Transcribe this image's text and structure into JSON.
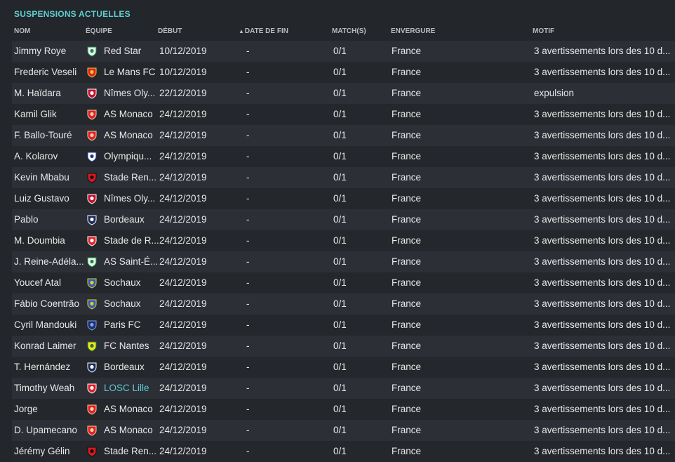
{
  "title": "SUSPENSIONS ACTUELLES",
  "columns": {
    "name": "NOM",
    "team": "ÉQUIPE",
    "start": "DÉBUT",
    "end": "DATE DE FIN",
    "matches": "MATCH(S)",
    "scope": "ENVERGURE",
    "reason": "MOTIF"
  },
  "rows": [
    {
      "name": "Jimmy Roye",
      "team": "Red Star",
      "start": "10/12/2019",
      "end": "-",
      "matches": "0/1",
      "scope": "France",
      "reason": "3 avertissements lors des 10 d...",
      "crest": "red-star",
      "color": "#e8f0ea",
      "accent": "#1f8a4c"
    },
    {
      "name": "Frederic Veseli",
      "team": "Le Mans FC",
      "start": "10/12/2019",
      "end": "-",
      "matches": "0/1",
      "scope": "France",
      "reason": "3 avertissements lors des 10 d...",
      "crest": "le-mans",
      "color": "#d8262a",
      "accent": "#f2c230"
    },
    {
      "name": "M. Haïdara",
      "team": "Nîmes Oly...",
      "start": "22/12/2019",
      "end": "-",
      "matches": "0/1",
      "scope": "France",
      "reason": "expulsion",
      "crest": "nimes",
      "color": "#c8102e",
      "accent": "#ffffff"
    },
    {
      "name": "Kamil Glik",
      "team": "AS Monaco",
      "start": "24/12/2019",
      "end": "-",
      "matches": "0/1",
      "scope": "France",
      "reason": "3 avertissements lors des 10 d...",
      "crest": "monaco",
      "color": "#e21d38",
      "accent": "#f0d68a"
    },
    {
      "name": "F. Ballo-Touré",
      "team": "AS Monaco",
      "start": "24/12/2019",
      "end": "-",
      "matches": "0/1",
      "scope": "France",
      "reason": "3 avertissements lors des 10 d...",
      "crest": "monaco",
      "color": "#e21d38",
      "accent": "#f0d68a"
    },
    {
      "name": "A. Kolarov",
      "team": "Olympiqu...",
      "start": "24/12/2019",
      "end": "-",
      "matches": "0/1",
      "scope": "France",
      "reason": "3 avertissements lors des 10 d...",
      "crest": "lyon",
      "color": "#ffffff",
      "accent": "#1c3b8c"
    },
    {
      "name": "Kevin Mbabu",
      "team": "Stade Ren...",
      "start": "24/12/2019",
      "end": "-",
      "matches": "0/1",
      "scope": "France",
      "reason": "3 avertissements lors des 10 d...",
      "crest": "rennes",
      "color": "#d71920",
      "accent": "#111111"
    },
    {
      "name": "Luiz Gustavo",
      "team": "Nîmes Oly...",
      "start": "24/12/2019",
      "end": "-",
      "matches": "0/1",
      "scope": "France",
      "reason": "3 avertissements lors des 10 d...",
      "crest": "nimes",
      "color": "#c8102e",
      "accent": "#ffffff"
    },
    {
      "name": "Pablo",
      "team": "Bordeaux",
      "start": "24/12/2019",
      "end": "-",
      "matches": "0/1",
      "scope": "France",
      "reason": "3 avertissements lors des 10 d...",
      "crest": "bordeaux",
      "color": "#1b2c5c",
      "accent": "#ffffff"
    },
    {
      "name": "M. Doumbia",
      "team": "Stade de R...",
      "start": "24/12/2019",
      "end": "-",
      "matches": "0/1",
      "scope": "France",
      "reason": "3 avertissements lors des 10 d...",
      "crest": "reims",
      "color": "#e3262d",
      "accent": "#ffffff"
    },
    {
      "name": "J. Reine-Adéla...",
      "team": "AS Saint-É...",
      "start": "24/12/2019",
      "end": "-",
      "matches": "0/1",
      "scope": "France",
      "reason": "3 avertissements lors des 10 d...",
      "crest": "saint-etienne",
      "color": "#e9f2ea",
      "accent": "#1b8a3e"
    },
    {
      "name": "Youcef Atal",
      "team": "Sochaux",
      "start": "24/12/2019",
      "end": "-",
      "matches": "0/1",
      "scope": "France",
      "reason": "3 avertissements lors des 10 d...",
      "crest": "sochaux",
      "color": "#2a62b4",
      "accent": "#f1c52e"
    },
    {
      "name": "Fábio Coentrão",
      "team": "Sochaux",
      "start": "24/12/2019",
      "end": "-",
      "matches": "0/1",
      "scope": "France",
      "reason": "3 avertissements lors des 10 d...",
      "crest": "sochaux",
      "color": "#2a62b4",
      "accent": "#f1c52e"
    },
    {
      "name": "Cyril Mandouki",
      "team": "Paris FC",
      "start": "24/12/2019",
      "end": "-",
      "matches": "0/1",
      "scope": "France",
      "reason": "3 avertissements lors des 10 d...",
      "crest": "paris-fc",
      "color": "#1d2f6e",
      "accent": "#7fa6dd"
    },
    {
      "name": "Konrad Laimer",
      "team": "FC Nantes",
      "start": "24/12/2019",
      "end": "-",
      "matches": "0/1",
      "scope": "France",
      "reason": "3 avertissements lors des 10 d...",
      "crest": "nantes",
      "color": "#f7e017",
      "accent": "#1a7a3a"
    },
    {
      "name": "T. Hernández",
      "team": "Bordeaux",
      "start": "24/12/2019",
      "end": "-",
      "matches": "0/1",
      "scope": "France",
      "reason": "3 avertissements lors des 10 d...",
      "crest": "bordeaux",
      "color": "#1b2c5c",
      "accent": "#ffffff"
    },
    {
      "name": "Timothy Weah",
      "team": "LOSC Lille",
      "start": "24/12/2019",
      "end": "-",
      "matches": "0/1",
      "scope": "France",
      "reason": "3 avertissements lors des 10 d...",
      "crest": "lille",
      "color": "#e01e2b",
      "accent": "#ffffff",
      "highlight": true
    },
    {
      "name": "Jorge",
      "team": "AS Monaco",
      "start": "24/12/2019",
      "end": "-",
      "matches": "0/1",
      "scope": "France",
      "reason": "3 avertissements lors des 10 d...",
      "crest": "monaco",
      "color": "#e21d38",
      "accent": "#f0d68a"
    },
    {
      "name": "D. Upamecano",
      "team": "AS Monaco",
      "start": "24/12/2019",
      "end": "-",
      "matches": "0/1",
      "scope": "France",
      "reason": "3 avertissements lors des 10 d...",
      "crest": "monaco",
      "color": "#e21d38",
      "accent": "#f0d68a"
    },
    {
      "name": "Jérémy Gélin",
      "team": "Stade Ren...",
      "start": "24/12/2019",
      "end": "-",
      "matches": "0/1",
      "scope": "France",
      "reason": "3 avertissements lors des 10 d...",
      "crest": "rennes",
      "color": "#d71920",
      "accent": "#111111"
    }
  ]
}
